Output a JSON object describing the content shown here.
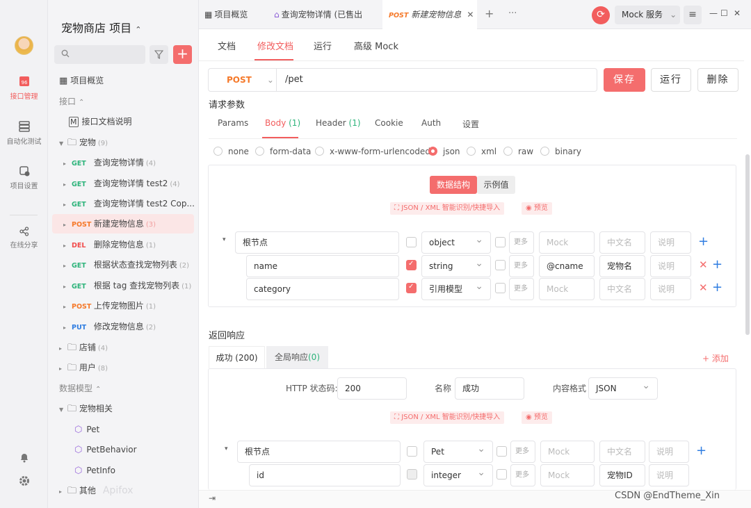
{
  "rail": {
    "items": [
      {
        "label": "接口管理",
        "icon": "api-icon",
        "active": true
      },
      {
        "label": "自动化测试",
        "icon": "test-icon"
      },
      {
        "label": "项目设置",
        "icon": "settings-icon"
      },
      {
        "label": "在线分享",
        "icon": "share-icon"
      }
    ]
  },
  "sidebar": {
    "project_title": "宠物商店 项目",
    "project_caret": "⌃⌄",
    "overview": "项目概览",
    "section_api": "接口",
    "api_doc": "接口文档说明",
    "folder_pets": {
      "label": "宠物",
      "count": "(9)"
    },
    "endpoints": [
      {
        "method": "GET",
        "label": "查询宠物详情",
        "count": "(4)"
      },
      {
        "method": "GET",
        "label": "查询宠物详情 test2",
        "count": "(4)"
      },
      {
        "method": "GET",
        "label": "查询宠物详情 test2 Cop...",
        "count": ""
      },
      {
        "method": "POST",
        "label": "新建宠物信息",
        "count": "(3)",
        "active": true
      },
      {
        "method": "DEL",
        "label": "删除宠物信息",
        "count": "(1)"
      },
      {
        "method": "GET",
        "label": "根据状态查找宠物列表",
        "count": "(2)"
      },
      {
        "method": "GET",
        "label": "根据 tag 查找宠物列表",
        "count": "(1)"
      },
      {
        "method": "POST",
        "label": "上传宠物图片",
        "count": "(1)"
      },
      {
        "method": "PUT",
        "label": "修改宠物信息",
        "count": "(2)"
      }
    ],
    "folder_shop": {
      "label": "店铺",
      "count": "(4)"
    },
    "folder_user": {
      "label": "用户",
      "count": "(8)"
    },
    "section_models": "数据模型",
    "folder_models": "宠物相关",
    "models": [
      "Pet",
      "PetBehavior",
      "PetInfo"
    ],
    "folder_other": "其他",
    "watermark": "Apifox"
  },
  "tabs": [
    {
      "label": "项目概览",
      "icon": "grid-icon"
    },
    {
      "label": "查询宠物详情 (已售出",
      "icon": "api-icon"
    },
    {
      "method": "POST",
      "label": "新建宠物信息",
      "active": true
    }
  ],
  "topbar": {
    "add": "+",
    "more": "···",
    "mock_service": "Mock 服务",
    "minimize": "—",
    "maximize": "☐",
    "close": "✕"
  },
  "subtabs": [
    "文档",
    "修改文档",
    "运行",
    "高级 Mock"
  ],
  "request": {
    "method": "POST",
    "path": "/pet",
    "save": "保存",
    "run": "运行",
    "delete": "删除",
    "params_title": "请求参数",
    "param_tabs": [
      {
        "label": "Params"
      },
      {
        "label": "Body",
        "count": "(1)",
        "active": true
      },
      {
        "label": "Header",
        "count": "(1)"
      },
      {
        "label": "Cookie"
      },
      {
        "label": "Auth"
      },
      {
        "label": "设置"
      }
    ],
    "body_types": [
      "none",
      "form-data",
      "x-www-form-urlencoded",
      "json",
      "xml",
      "raw",
      "binary"
    ],
    "body_selected": "json"
  },
  "schema": {
    "tab_struct": "数据结构",
    "tab_example": "示例值",
    "import_hint": "JSON / XML 智能识别/快捷导入",
    "preview": "预览",
    "more": "更多",
    "mock_placeholder": "Mock",
    "cn_placeholder": "中文名",
    "desc_placeholder": "说明",
    "rows": [
      {
        "name": "根节点",
        "type": "object",
        "required": false,
        "mock": "",
        "cn": ""
      },
      {
        "name": "name",
        "type": "string",
        "required": true,
        "mock": "@cname",
        "cn": "宠物名"
      },
      {
        "name": "category",
        "type": "引用模型",
        "required": true,
        "mock": "",
        "cn": ""
      }
    ]
  },
  "response": {
    "title": "返回响应",
    "tab_success": "成功 (200)",
    "tab_global": "全局响应",
    "tab_global_count": "(0)",
    "add": "+ 添加",
    "http_code_label": "HTTP 状态码:",
    "http_code": "200",
    "name_label": "名称",
    "name": "成功",
    "format_label": "内容格式",
    "format": "JSON",
    "rows": [
      {
        "name": "根节点",
        "type": "Pet",
        "cn": ""
      },
      {
        "name": "id",
        "type": "integer",
        "cn": "宠物ID"
      }
    ]
  },
  "footer": {
    "watermark": "CSDN @EndTheme_Xin"
  }
}
